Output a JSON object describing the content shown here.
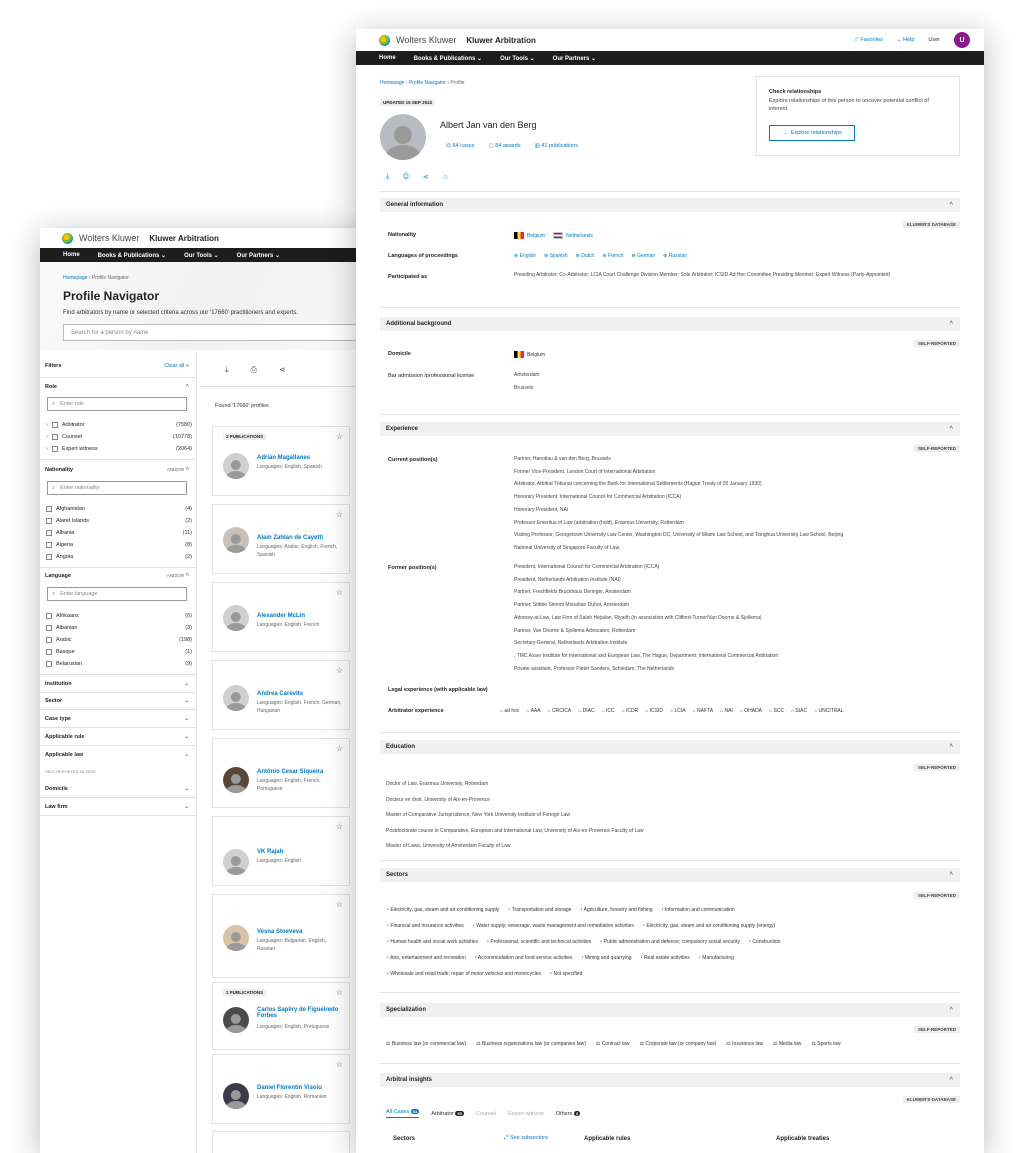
{
  "back": {
    "brand": "Wolters Kluwer",
    "product": "Kluwer Arbitration",
    "menu": [
      "Home",
      "Books & Publications",
      "Our Tools",
      "Our Partners"
    ],
    "breadcrumb": [
      "Homepage",
      "Profile Navigator"
    ],
    "title": "Profile Navigator",
    "subtitle": "Find arbitrators by name or selected criteria across our '17660' practitioners and experts.",
    "search_placeholder": "Search for a person by name",
    "filters_label": "Filters",
    "clear_all": "Clear all",
    "role": {
      "label": "Role",
      "placeholder": "Enter role",
      "items": [
        {
          "name": "Arbitrator",
          "count": "(7580)"
        },
        {
          "name": "Counsel",
          "count": "(10778)"
        },
        {
          "name": "Expert witness",
          "count": "(2064)"
        }
      ]
    },
    "nationality": {
      "label": "Nationality",
      "mode": "AND|OR",
      "placeholder": "Enter nationality",
      "items": [
        {
          "name": "Afghanistan",
          "count": "(4)"
        },
        {
          "name": "Aland Islands",
          "count": "(2)"
        },
        {
          "name": "Albania",
          "count": "(11)"
        },
        {
          "name": "Algeria",
          "count": "(8)"
        },
        {
          "name": "Angola",
          "count": "(2)"
        }
      ]
    },
    "language": {
      "label": "Language",
      "mode": "AND|OR",
      "placeholder": "Enter language",
      "items": [
        {
          "name": "Afrikaans",
          "count": "(6)"
        },
        {
          "name": "Albanian",
          "count": "(3)"
        },
        {
          "name": "Arabic",
          "count": "(198)"
        },
        {
          "name": "Basque",
          "count": "(1)"
        },
        {
          "name": "Belarusian",
          "count": "(9)"
        }
      ]
    },
    "more_filters": [
      "Institution",
      "Sector",
      "Case type",
      "Applicable rule",
      "Applicable law"
    ],
    "self_reported_label": "SELF-REPORTED FILTERS",
    "more_filters2": [
      "Domicile",
      "Law firm"
    ],
    "found": "Found '17660' profiles",
    "publications_badge": "2 PUBLICATIONS",
    "cards": [
      {
        "name": "Adrián Magallanes",
        "langs": "Languages: English, Spanish",
        "badge": true
      },
      {
        "name": "Alain Zahlan de Cayetti",
        "langs": "Languages: Arabic, English, French, Spanish",
        "badge": false
      },
      {
        "name": "Alexander McLin",
        "langs": "Languages: English, French",
        "badge": false
      },
      {
        "name": "Andrea Carevits",
        "langs": "Languages: English, French, German, Hungarian",
        "badge": false
      },
      {
        "name": "Antônio Cesar Siqueira",
        "langs": "Languages: English, French, Portuguese",
        "badge": false
      },
      {
        "name": "VK Rajah",
        "langs": "Languages: English",
        "badge": false
      },
      {
        "name": "Vesna Stoeveva",
        "langs": "Languages: Bulgarian, English, Russian",
        "badge": false
      },
      {
        "name": "Carlos Sapliry de Figueiredo Forbes",
        "langs": "Languages: English, Portuguese",
        "badge": true
      },
      {
        "name": "Daniel Florentin Visoiu",
        "langs": "Languages: English, Romanian",
        "badge": false
      }
    ]
  },
  "front": {
    "brand": "Wolters Kluwer",
    "product": "Kluwer Arbitration",
    "favorites": "Favorites",
    "help": "Help",
    "user": "User",
    "user_initial": "U",
    "menu": [
      "Home",
      "Books & Publications",
      "Our Tools",
      "Our Partners"
    ],
    "breadcrumb": [
      "Homepage",
      "Profile Navigator",
      "Profile"
    ],
    "updated": "UPDATED 15 SEP 2022",
    "name": "Albert Jan van den Berg",
    "stats": [
      "64 cases",
      "84 awards",
      "41 publications"
    ],
    "relationships": {
      "title": "Check relationships",
      "text": "Explore relationships of this person to uncover potential conflict of interest.",
      "button": "Explore relationships"
    },
    "general": {
      "title": "General information",
      "tag": "KLUWER'S DATABASE",
      "nationality_label": "Nationality",
      "nationalities": [
        "Belgium",
        "Netherlands"
      ],
      "languages_label": "Languages of proceedings",
      "languages": [
        "English",
        "Spanish",
        "Dutch",
        "French",
        "German",
        "Russian"
      ],
      "participated_label": "Participated as",
      "participated": "Presiding Arbitrator; Co-Arbitrator; LCIA Court Challenge Division Member; Sole Arbitrator; ICSID Ad Hoc Committee Presiding Member; Expert Witness (Party-Appointed)"
    },
    "background": {
      "title": "Additional background",
      "tag": "SELF-REPORTED",
      "domicile_label": "Domicile",
      "domicile": "Belgium",
      "bar_label": "Bar admission /professional license",
      "bar": [
        "Amsterdam",
        "Brussels"
      ]
    },
    "experience": {
      "title": "Experience",
      "tag": "SELF-REPORTED",
      "current_label": "Current position(s)",
      "current": [
        "Partner, Hanotiau & van den Berg, Brussels",
        "Former Vice-President, London Court of International Arbitration",
        "Arbitrator, Arbitral Tribunal concerning the Bank for International Settlements (Hague Treaty of 20 January 1930)",
        "Honorary President, International Council for Commercial Arbitration (ICCA)",
        "Honorary President, NAI",
        "Professor Emeritus of Law (arbitration (hold), Erasmus University, Rotterdam",
        "Visiting Professor, Georgetown University Law Center, Washington DC, University of Miami Law School, and Tsinghua University Law School, Beijing",
        "National University of Singapore Faculty of Law,"
      ],
      "former_label": "Former position(s)",
      "former": [
        "President, International Council for Commercial Arbitration (ICCA)",
        "President, Netherlands Arbitration Institute (NAI)",
        "Partner, Freshfields Bruckhaus Deringer, Amsterdam",
        "Partner, Stibbe Simont Monahan Duhot, Amsterdam",
        "Attorney-at-Law, Law Firm of Salah Hejailan, Riyadh (in association with Clifford-Turner/Van Doorne & Sjollema)",
        "Partner, Van Doorne & Sjollema Advocaten, Rotterdam",
        "Secretary-General, Netherlands Arbitration Institute",
        ", TMC Asser Institute for International and European Law, The Hague, Department: International Commercial Arbitration",
        "Private assistant, Professor Pieter Sanders, Schiedam, The Netherlands"
      ],
      "legal_label": "Legal experience (with applicable law)",
      "arb_label": "Arbitrator experience",
      "institutions": [
        "ad hoc",
        "AAA",
        "CRCICA",
        "DIAC",
        "ICC",
        "ICDR",
        "ICSID",
        "LCIA",
        "NAFTA",
        "NAI",
        "OHADA",
        "SCC",
        "SIAC",
        "UNCITRAL"
      ]
    },
    "education": {
      "title": "Education",
      "tag": "SELF-REPORTED",
      "items": [
        "Doctor of Law, Erasmus University, Rotterdam",
        "Docteur en droit, University of Aix-en-Provence",
        "Master of Comparative Jurisprudence, New York University Institute of Foreign Law",
        "Postdoctorate course in Comparative, European and International Law, University of Aix-en-Provence Faculty of Law",
        "Master of Laws, University of Amsterdam Faculty of Law"
      ]
    },
    "sectors": {
      "title": "Sectors",
      "tag": "SELF-REPORTED",
      "rows": [
        [
          "Electricity, gas, steam and air conditioning supply",
          "Transportation and storage",
          "Agriculture, forestry and fishing",
          "Information and communication"
        ],
        [
          "Financial and insurance activities",
          "Water supply; sewerage, waste management and remediation activities",
          "Electricity, gas, steam and air conditioning supply (energy)"
        ],
        [
          "Human health and social work activities",
          "Professional, scientific and technical activities",
          "Public administration and defence; compulsory social security",
          "Construction"
        ],
        [
          "Arts, entertainment and recreation",
          "Accommodation and food service activities",
          "Mining and quarrying",
          "Real estate activities",
          "Manufacturing"
        ],
        [
          "Wholesale and retail trade; repair of motor vehicles and motorcycles",
          "Not specified"
        ]
      ]
    },
    "specialization": {
      "title": "Specialization",
      "tag": "SELF-REPORTED",
      "items": [
        "Business law (or commercial law)",
        "Business organizations law (or companies law)",
        "Contract law",
        "Corporate law (or company law)",
        "Insurance law",
        "Media law",
        "Sports law"
      ]
    },
    "insights": {
      "title": "Arbitral insights",
      "tag": "KLUWER'S DATABASE",
      "tabs": [
        "All Cases",
        "Arbitrator",
        "Counsel",
        "Expert witness",
        "Others"
      ],
      "tab_counts": [
        "64",
        "55",
        "",
        "",
        "3"
      ],
      "cols": [
        "Sectors",
        "See subsectors",
        "Applicable rules",
        "Applicable treaties"
      ]
    }
  }
}
